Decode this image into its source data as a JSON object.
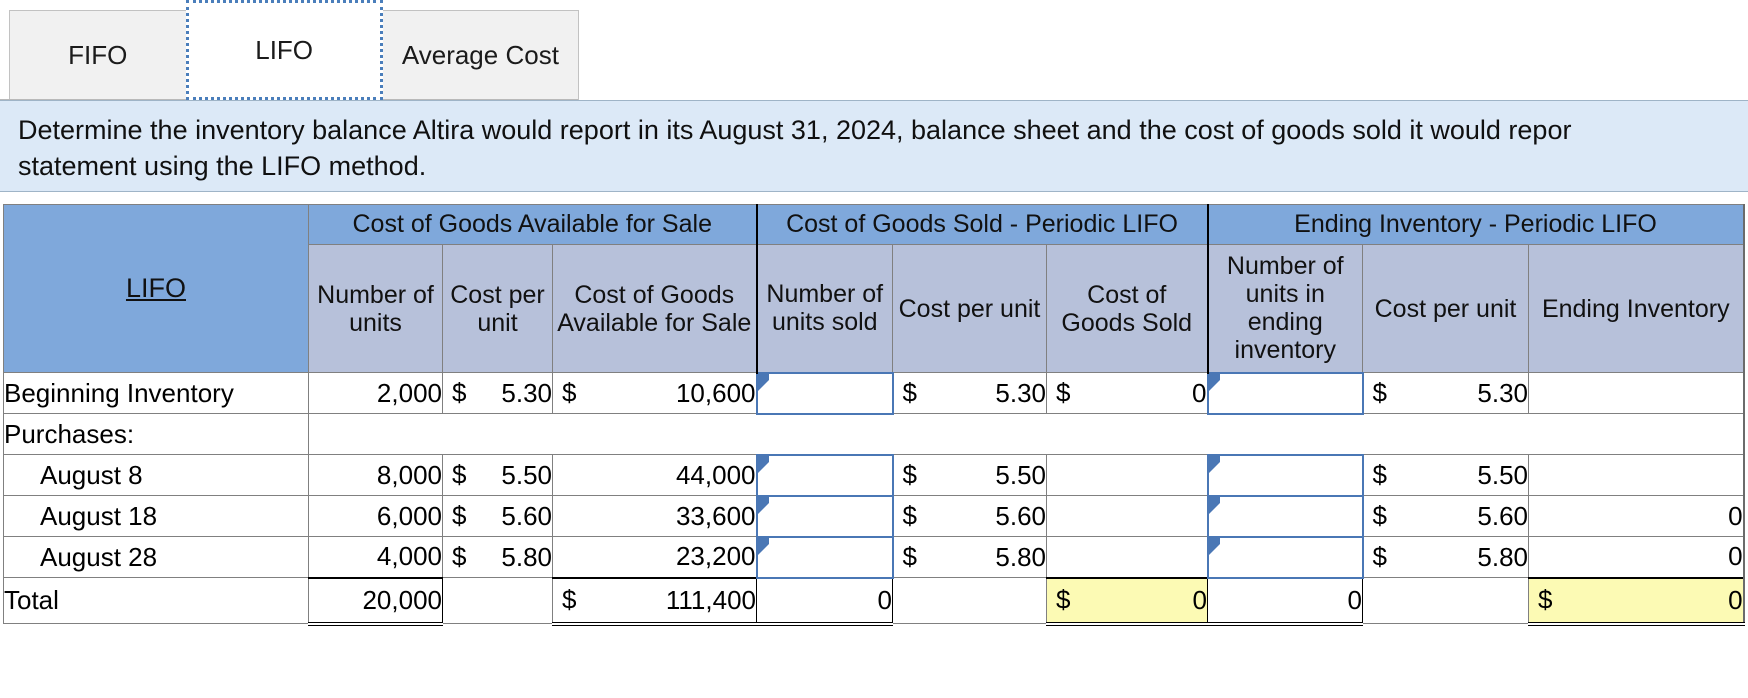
{
  "tabs": [
    {
      "label": "FIFO",
      "active": false
    },
    {
      "label": "LIFO",
      "active": true
    },
    {
      "label": "Average Cost",
      "active": false
    }
  ],
  "instruction": {
    "line1": "Determine the inventory balance Altira would report in its August 31, 2024, balance sheet and the cost of goods sold it would repor",
    "line2": "statement using the LIFO method."
  },
  "table": {
    "corner_label": "LIFO",
    "group_headers": [
      "Cost of Goods Available for Sale",
      "Cost of Goods Sold - Periodic LIFO",
      "Ending Inventory - Periodic LIFO"
    ],
    "column_headers": [
      "Number of units",
      "Cost per unit",
      "Cost of Goods Available for Sale",
      "Number of units sold",
      "Cost per unit",
      "Cost of Goods Sold",
      "Number of units in ending inventory",
      "Cost per unit",
      "Ending Inventory"
    ],
    "rows": [
      {
        "label": "Beginning Inventory",
        "avail_units": "2,000",
        "avail_cost_cur": "$",
        "avail_cost": "5.30",
        "avail_total_cur": "$",
        "avail_total": "10,600",
        "sold_units": "",
        "sold_cost_cur": "$",
        "sold_cost": "5.30",
        "cogs_cur": "$",
        "cogs": "0",
        "end_units": "",
        "end_cost_cur": "$",
        "end_cost": "5.30",
        "end_inv": ""
      },
      {
        "label": "Purchases:",
        "spanner": true
      },
      {
        "label": "August 8",
        "indent": true,
        "avail_units": "8,000",
        "avail_cost_cur": "$",
        "avail_cost": "5.50",
        "avail_total_cur": "",
        "avail_total": "44,000",
        "sold_units": "",
        "sold_cost_cur": "$",
        "sold_cost": "5.50",
        "cogs_cur": "",
        "cogs": "",
        "end_units": "",
        "end_cost_cur": "$",
        "end_cost": "5.50",
        "end_inv": ""
      },
      {
        "label": "August 18",
        "indent": true,
        "avail_units": "6,000",
        "avail_cost_cur": "$",
        "avail_cost": "5.60",
        "avail_total_cur": "",
        "avail_total": "33,600",
        "sold_units": "",
        "sold_cost_cur": "$",
        "sold_cost": "5.60",
        "cogs_cur": "",
        "cogs": "",
        "end_units": "",
        "end_cost_cur": "$",
        "end_cost": "5.60",
        "end_inv": "0"
      },
      {
        "label": "August 28",
        "indent": true,
        "avail_units": "4,000",
        "avail_cost_cur": "$",
        "avail_cost": "5.80",
        "avail_total_cur": "",
        "avail_total": "23,200",
        "sold_units": "",
        "sold_cost_cur": "$",
        "sold_cost": "5.80",
        "cogs_cur": "",
        "cogs": "",
        "end_units": "",
        "end_cost_cur": "$",
        "end_cost": "5.80",
        "end_inv": "0"
      }
    ],
    "total": {
      "label": "Total",
      "avail_units": "20,000",
      "avail_cost": "",
      "avail_total_cur": "$",
      "avail_total": "111,400",
      "sold_units": "0",
      "sold_cost": "",
      "cogs_cur": "$",
      "cogs": "0",
      "end_units": "0",
      "end_cost": "",
      "end_inv_cur": "$",
      "end_inv": "0"
    }
  },
  "colors": {
    "band": "#7fa8db",
    "subhead": "#b7c1da",
    "banner": "#dce9f7",
    "highlight": "#fcfab4",
    "input_border": "#4a77b5"
  }
}
